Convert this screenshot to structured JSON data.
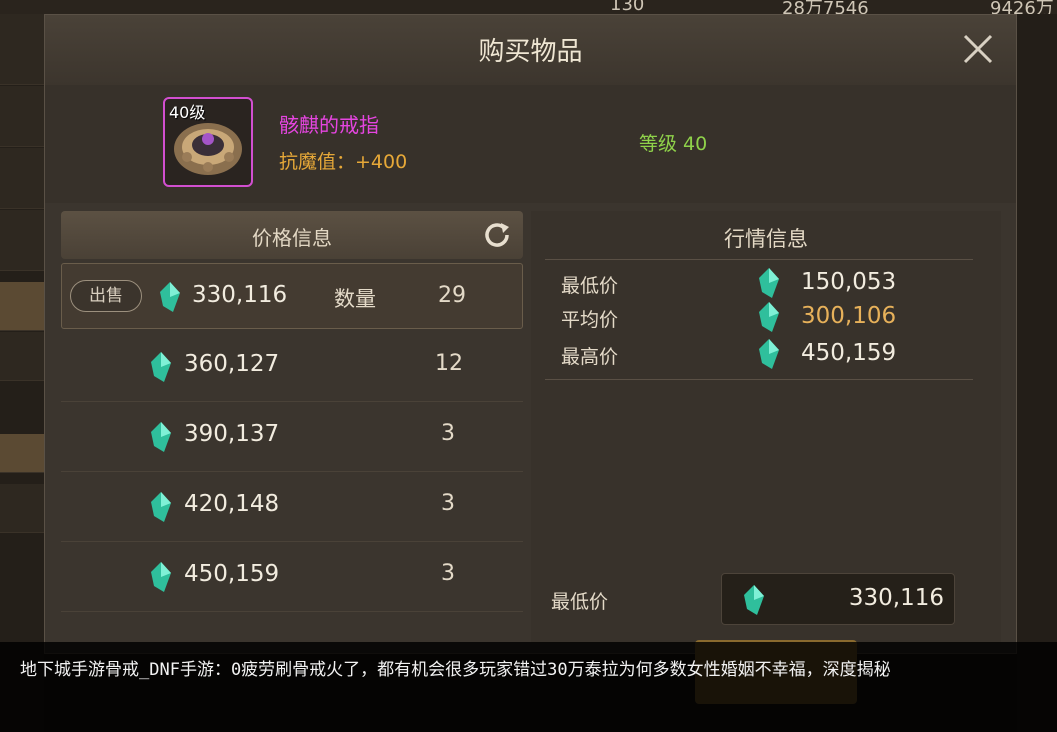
{
  "background": {
    "top_values": [
      "130",
      "28万7546",
      "9426万"
    ]
  },
  "dialog": {
    "title": "购买物品",
    "item": {
      "level_badge": "40级",
      "name": "骸麒的戒指",
      "stat": "抗魔值：+400",
      "grade": "等级 40"
    },
    "price_info": {
      "header": "价格信息",
      "sell_label": "出售",
      "quantity_label": "数量",
      "selected": {
        "price": "330,116",
        "quantity": "29"
      },
      "rows": [
        {
          "price": "360,127",
          "quantity": "12"
        },
        {
          "price": "390,137",
          "quantity": "3"
        },
        {
          "price": "420,148",
          "quantity": "3"
        },
        {
          "price": "450,159",
          "quantity": "3"
        }
      ]
    },
    "market_info": {
      "header": "行情信息",
      "min_label": "最低价",
      "min_value": "150,053",
      "avg_label": "平均价",
      "avg_value": "300,106",
      "max_label": "最高价",
      "max_value": "450,159",
      "lowest_label": "最低价",
      "lowest_value": "330,116"
    }
  },
  "caption": {
    "text": "地下城手游骨戒_DNF手游：0疲劳刷骨戒火了，都有机会很多玩家错过30万泰拉为何多数女性婚姻不幸福，深度揭秘"
  },
  "colors": {
    "item_name": "#e545e0",
    "stat": "#e6a838",
    "grade": "#8fd24a",
    "avg_price": "#e7b15a",
    "gem": "#3fd3b0"
  }
}
